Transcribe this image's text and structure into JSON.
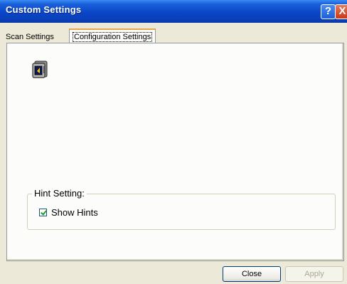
{
  "window": {
    "title": "Custom Settings"
  },
  "titlebar": {
    "help_glyph": "?",
    "close_glyph": "X"
  },
  "tabs": [
    {
      "label": "Scan Settings",
      "selected": false
    },
    {
      "label": "Configuration Settings",
      "selected": true
    }
  ],
  "panel": {
    "icon": "camera-icon",
    "hint_group": {
      "legend": "Hint Setting:",
      "show_hints": {
        "label": "Show Hints",
        "checked": true
      }
    }
  },
  "buttons": {
    "close": "Close",
    "apply": "Apply",
    "apply_enabled": false
  },
  "colors": {
    "titlebar": "#0a46c8",
    "dialog_bg": "#ece9d8",
    "panel_bg": "#fcfcfa",
    "tab_highlight": "#e6a74a",
    "checkmark": "#21a121"
  }
}
